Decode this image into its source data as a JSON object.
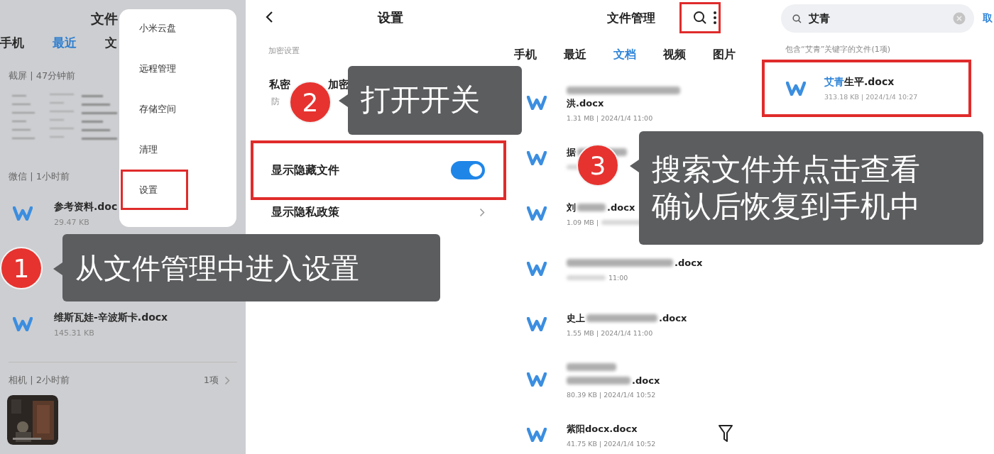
{
  "left_panel": {
    "title": "文件",
    "tabs": [
      {
        "label": "手机",
        "selected": false
      },
      {
        "label": "最近",
        "selected": true
      },
      {
        "label": "文",
        "selected": false
      }
    ],
    "groups": [
      {
        "kind": "thumbnails",
        "header": "截屏 | 47分钟前"
      },
      {
        "kind": "files",
        "header": "微信 | 1小时前",
        "files": [
          {
            "name": "参考资料.doc",
            "meta": "29.47 KB"
          },
          {
            "name": "维斯瓦娃-辛波斯卡.docx",
            "meta": "145.31 KB"
          }
        ]
      },
      {
        "kind": "photos",
        "header": "相机 | 2小时前",
        "count": "1项"
      }
    ],
    "menu": {
      "items": [
        {
          "label": "小米云盘",
          "highlighted": false
        },
        {
          "label": "远程管理",
          "highlighted": false
        },
        {
          "label": "存储空间",
          "highlighted": false
        },
        {
          "label": "清理",
          "highlighted": false
        },
        {
          "label": "设置",
          "highlighted": true
        }
      ]
    }
  },
  "settings": {
    "title": "设置",
    "section": "加密设置",
    "rows": [
      {
        "kind": "text",
        "title_parts": [
          "私密",
          "加密"
        ],
        "subtitle": "防",
        "highlighted": false
      },
      {
        "kind": "toggle",
        "title": "显示隐藏文件",
        "on": true,
        "highlighted": true
      },
      {
        "kind": "link",
        "title": "显示隐私政策",
        "highlighted": false
      }
    ]
  },
  "files_panel": {
    "title": "文件管理",
    "search_highlighted": true,
    "tabs": [
      {
        "label": "手机",
        "selected": false
      },
      {
        "label": "最近",
        "selected": false
      },
      {
        "label": "文档",
        "selected": true
      },
      {
        "label": "视频",
        "selected": false
      },
      {
        "label": "图片",
        "selected": false
      }
    ],
    "files": [
      {
        "name": [
          [
            {
              "kind": "blur"
            }
          ],
          [
            {
              "kind": "text",
              "text": "洪.docx"
            }
          ]
        ],
        "meta": [
          {
            "kind": "text",
            "text": "1.31 MB | 2024/1/4 11:00"
          }
        ]
      },
      {
        "name": [
          [
            {
              "kind": "text",
              "text": "据"
            },
            {
              "kind": "blur"
            }
          ]
        ],
        "meta": [
          {
            "kind": "blur"
          }
        ]
      },
      {
        "name": [
          [
            {
              "kind": "text",
              "text": "刘"
            },
            {
              "kind": "blur"
            },
            {
              "kind": "text",
              "text": ".docx"
            }
          ]
        ],
        "meta": [
          {
            "kind": "text",
            "text": "1.09 MB |"
          },
          {
            "kind": "blur"
          }
        ]
      },
      {
        "name": [
          [
            {
              "kind": "blur"
            },
            {
              "kind": "text",
              "text": ".docx"
            }
          ]
        ],
        "meta": [
          {
            "kind": "blur"
          },
          {
            "kind": "text",
            "text": "11:00"
          }
        ]
      },
      {
        "name": [
          [
            {
              "kind": "text",
              "text": "史上"
            },
            {
              "kind": "blur"
            },
            {
              "kind": "text",
              "text": ".docx"
            }
          ]
        ],
        "meta": [
          {
            "kind": "text",
            "text": "1.55 MB | 2024/1/4 11:00"
          }
        ]
      },
      {
        "name": [
          [
            {
              "kind": "blur"
            }
          ],
          [
            {
              "kind": "blur"
            },
            {
              "kind": "text",
              "text": ".docx"
            }
          ]
        ],
        "meta": [
          {
            "kind": "text",
            "text": "80.39 KB | 2024/1/4 10:52"
          }
        ]
      },
      {
        "name": [
          [
            {
              "kind": "text",
              "text": "紫阳docx.docx"
            }
          ]
        ],
        "meta": [
          {
            "kind": "text",
            "text": "41.75 KB | 2024/1/4 10:52"
          }
        ]
      }
    ]
  },
  "search_panel": {
    "query": "艾青",
    "cancel": "取",
    "summary": "包含“艾青”关键字的文件(1项)",
    "results": [
      {
        "match": "艾青",
        "rest": "生平.docx",
        "meta": "313.18 KB | 2024/1/4 10:27",
        "highlighted": true
      }
    ]
  },
  "callouts": [
    {
      "number": "1",
      "lines": [
        "从文件管理中进入设置"
      ]
    },
    {
      "number": "2",
      "lines": [
        "打开开关"
      ]
    },
    {
      "number": "3",
      "lines": [
        "搜索文件并点击查看",
        "确认后恢复到手机中"
      ]
    }
  ]
}
